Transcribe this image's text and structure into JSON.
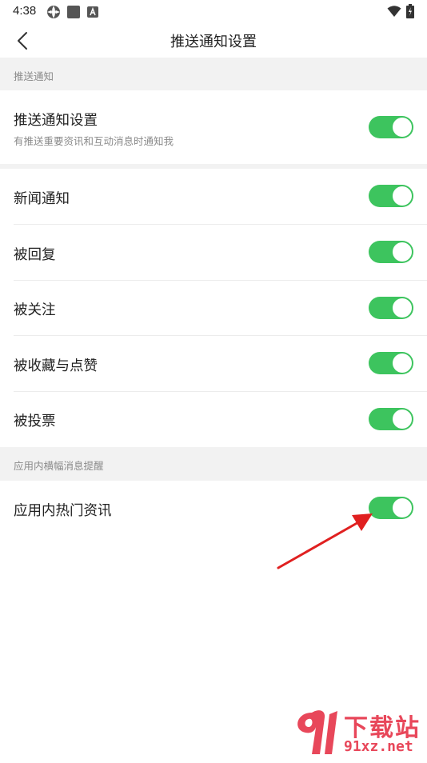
{
  "status_bar": {
    "time": "4:38"
  },
  "header": {
    "title": "推送通知设置",
    "back_icon": "chevron-left-icon"
  },
  "sections": [
    {
      "label": "推送通知"
    },
    {
      "label": "应用内横幅消息提醒"
    }
  ],
  "master_setting": {
    "title": "推送通知设置",
    "subtitle": "有推送重要资讯和互动消息时通知我",
    "enabled": true
  },
  "notification_items": [
    {
      "label": "新闻通知",
      "enabled": true
    },
    {
      "label": "被回复",
      "enabled": true
    },
    {
      "label": "被关注",
      "enabled": true
    },
    {
      "label": "被收藏与点赞",
      "enabled": true
    },
    {
      "label": "被投票",
      "enabled": true
    }
  ],
  "banner_items": [
    {
      "label": "应用内热门资讯",
      "enabled": true
    }
  ],
  "colors": {
    "toggle_on": "#3dc45e",
    "section_bg": "#f2f2f2",
    "annotation_arrow": "#e02020",
    "watermark": "#e8475a"
  },
  "watermark": {
    "line1": "下载站",
    "line2": "91xz.net"
  }
}
